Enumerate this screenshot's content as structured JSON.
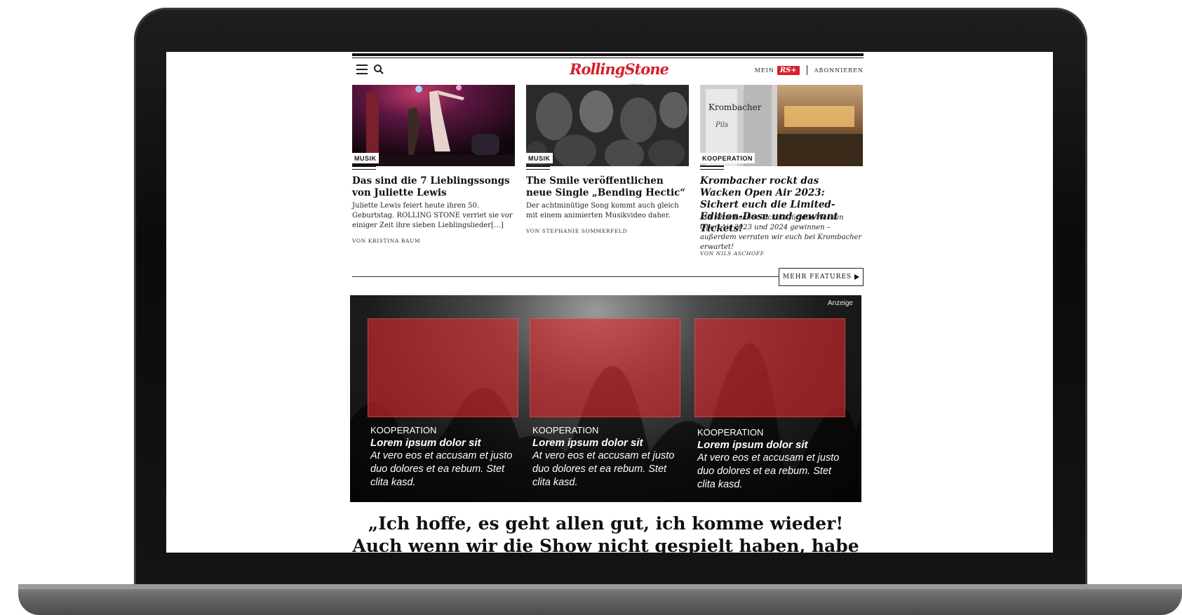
{
  "header": {
    "logo": "RollingStone",
    "logo_sub": "GERMANY",
    "mein_label": "MEIN",
    "rsplus_label": "RS+",
    "subscribe_label": "ABONNIEREN"
  },
  "cards": [
    {
      "tag": "MUSIK",
      "title": "Das sind die 7 Lieblingssongs von Juliette Lewis",
      "description": "Juliette Lewis feiert heute ihren 50. Geburtstag. ROLLING STONE verriet sie vor einiger Zeit ihre sieben Lieblingslieder[…]",
      "author": "VON KRISTINA BAUM"
    },
    {
      "tag": "MUSIK",
      "title": "The Smile veröffentlichen neue Single „Bending Hectic“",
      "description": "Der achtminütige Song kommt auch gleich mit einem animierten Musikvideo daher.",
      "author": "VON STEPHANIE SOMMERFELD"
    },
    {
      "tag": "KOOPERATION",
      "title": "Krombacher rockt das Wacken Open Air 2023: Sichert euch die Limited-Edition-Dose und gewinnt Tickets!",
      "description": "Mit Krombacher Tickets für das Wacken Open Air 2023 und 2024 gewinnen – außerdem verraten wir euch bei Krombacher erwartet!",
      "author": "VON NILS ASCHOFF"
    }
  ],
  "mehr_features": {
    "label": "MEHR FEATURES"
  },
  "ad": {
    "label": "Anzeige",
    "items": [
      {
        "kicker": "KOOPERATION",
        "title": "Lorem ipsum dolor sit",
        "body": "At vero eos et accusam et justo duo dolores et ea rebum. Stet clita kasd."
      },
      {
        "kicker": "KOOPERATION",
        "title": "Lorem ipsum dolor sit",
        "body": "At vero eos et accusam et justo duo dolores et ea rebum. Stet clita kasd."
      },
      {
        "kicker": "KOOPERATION",
        "title": "Lorem ipsum dolor sit",
        "body": "At vero eos et accusam et justo duo dolores et ea rebum. Stet clita kasd."
      }
    ]
  },
  "quote": "„Ich hoffe, es geht allen gut, ich komme wieder! Auch wenn wir die Show nicht gespielt haben, habe ich eure",
  "colors": {
    "brand": "#d6202b",
    "ad_tile": "#dc282d"
  }
}
